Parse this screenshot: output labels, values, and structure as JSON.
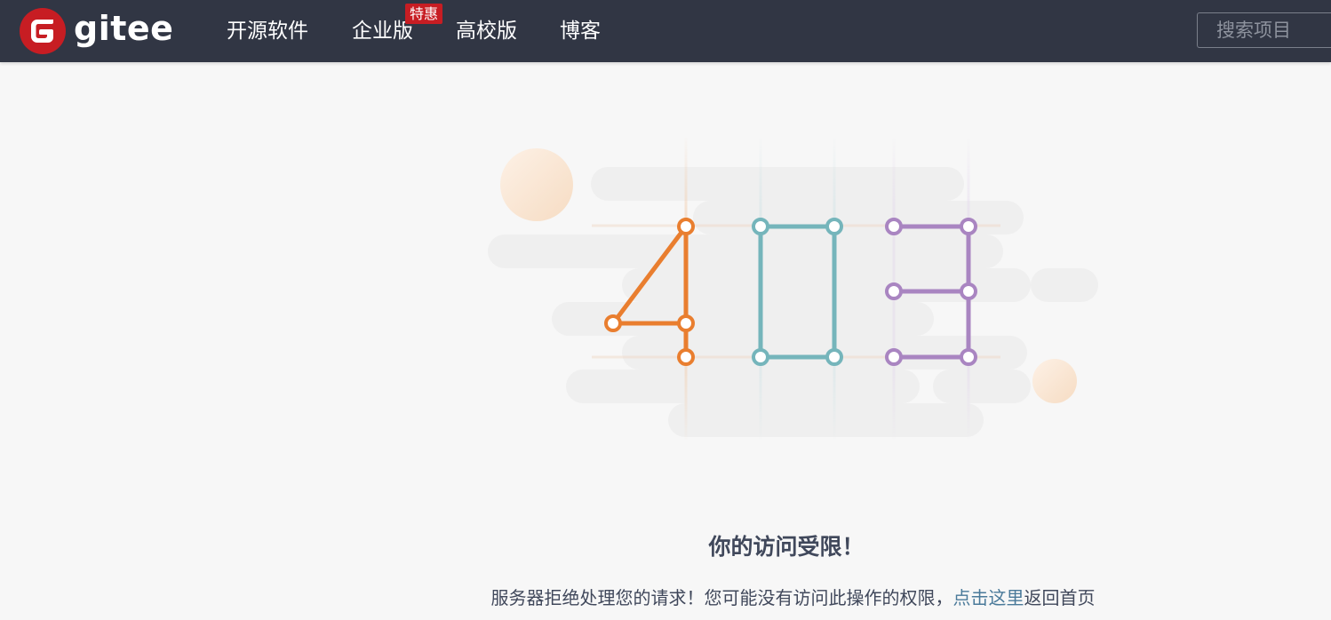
{
  "header": {
    "logo_text": "gitee",
    "nav": [
      {
        "label": "开源软件"
      },
      {
        "label": "企业版"
      },
      {
        "label": "高校版"
      },
      {
        "label": "博客"
      }
    ],
    "badge": "特惠",
    "search_placeholder": "搜索项目"
  },
  "error": {
    "title": "你的访问受限！",
    "desc_before": "服务器拒绝处理您的请求！您可能没有访问此操作的权限，",
    "link_text": "点击这里",
    "desc_after": "返回首页"
  },
  "colors": {
    "navbar": "#313644",
    "brand_red": "#c71d23",
    "digit_4": "#e97e2f",
    "digit_0": "#75b5bb",
    "digit_3": "#a985c1",
    "text": "#40485b",
    "link": "#4a7a9a"
  },
  "icons": [
    "gitee-logo-icon"
  ]
}
